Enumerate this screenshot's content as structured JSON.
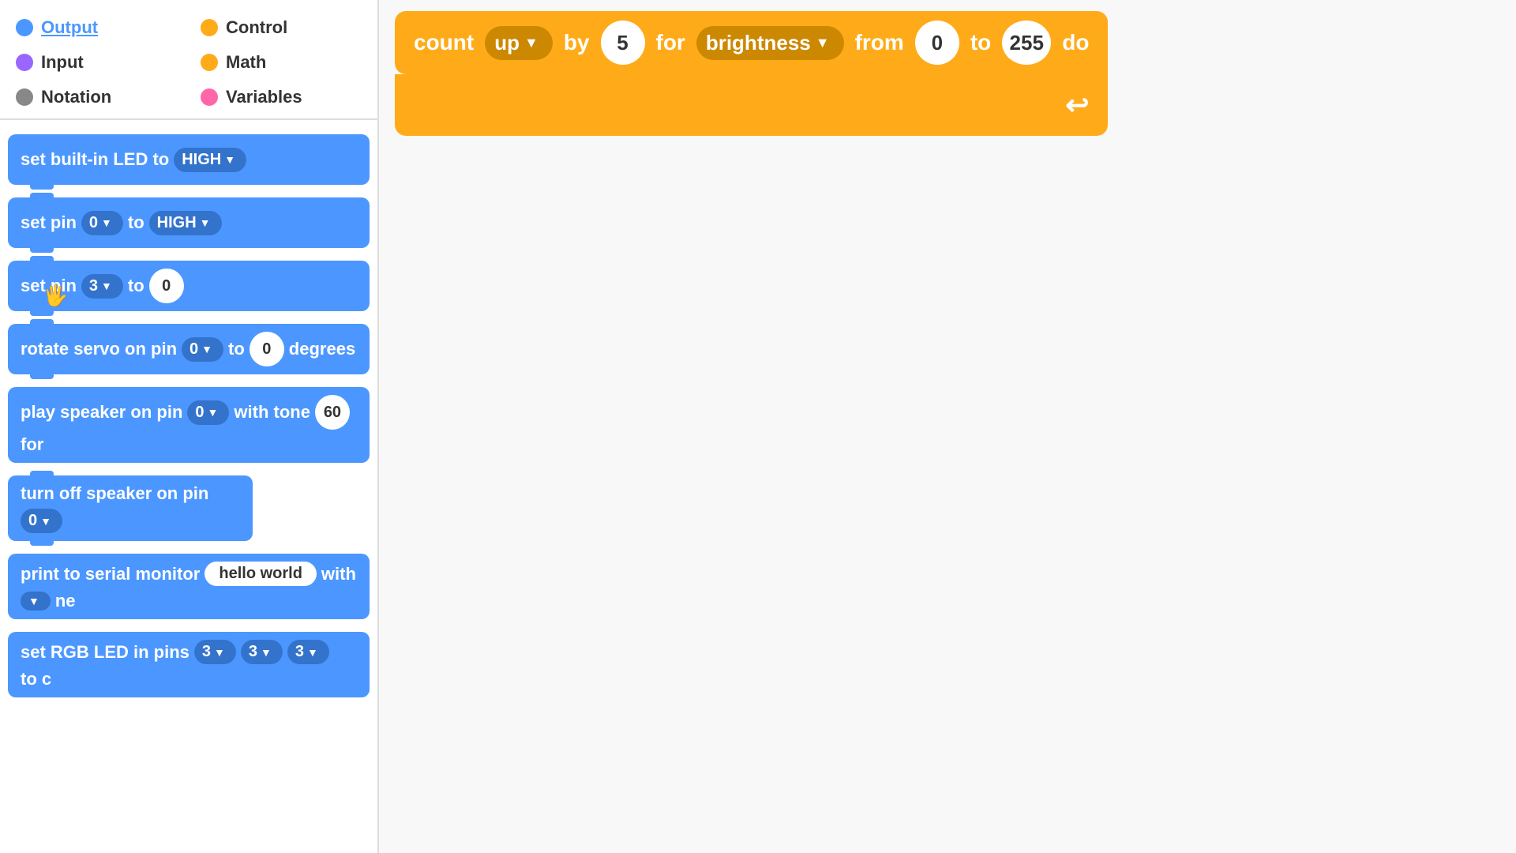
{
  "categories": [
    {
      "id": "output",
      "label": "Output",
      "color": "#4C97FF",
      "active": true
    },
    {
      "id": "control",
      "label": "Control",
      "color": "#FFAB19",
      "active": false
    },
    {
      "id": "input",
      "label": "Input",
      "color": "#9966FF",
      "active": false
    },
    {
      "id": "math",
      "label": "Math",
      "color": "#FFAB19",
      "active": false
    },
    {
      "id": "notation",
      "label": "Notation",
      "color": "#888",
      "active": false
    },
    {
      "id": "variables",
      "label": "Variables",
      "color": "#FF66AA",
      "active": false
    }
  ],
  "blocks": [
    {
      "id": "set-builtin-led",
      "parts": [
        "set built-in LED to",
        "HIGH"
      ]
    },
    {
      "id": "set-pin-high",
      "parts": [
        "set pin",
        "0",
        "to",
        "HIGH"
      ]
    },
    {
      "id": "set-pin-value",
      "parts": [
        "set pin",
        "3",
        "to",
        "0"
      ]
    },
    {
      "id": "rotate-servo",
      "parts": [
        "rotate servo on pin",
        "0",
        "to",
        "0",
        "degrees"
      ]
    },
    {
      "id": "play-speaker",
      "parts": [
        "play speaker on pin",
        "0",
        "with tone",
        "60",
        "for"
      ]
    },
    {
      "id": "turn-off-speaker",
      "parts": [
        "turn off speaker on pin",
        "0"
      ]
    },
    {
      "id": "print-serial",
      "parts": [
        "print to serial monitor",
        "hello world",
        "with",
        "ne"
      ]
    },
    {
      "id": "set-rgb-led",
      "parts": [
        "set RGB LED in pins",
        "3",
        "3",
        "3",
        "to c"
      ]
    }
  ],
  "orange_block": {
    "parts": [
      "count",
      "up",
      "by",
      "5",
      "for",
      "brightness",
      "from",
      "0",
      "to",
      "255",
      "do"
    ],
    "up_label": "up",
    "by_label": "by",
    "value_5": "5",
    "for_label": "for",
    "brightness_label": "brightness",
    "from_label": "from",
    "value_0_from": "0",
    "to_label": "to",
    "value_255": "255",
    "do_label": "do"
  }
}
